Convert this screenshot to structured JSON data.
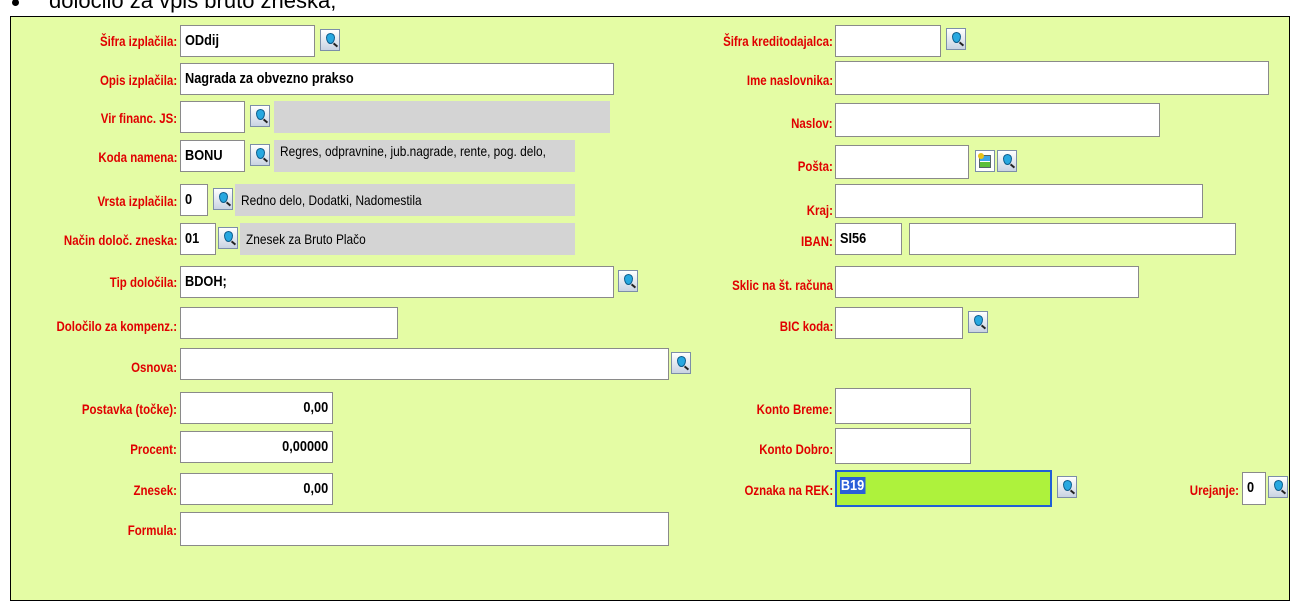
{
  "caption": "določilo za vpis bruto zneska;",
  "left": {
    "sifra_izplacila": {
      "label": "Šifra izplačila:",
      "value": "ODdij"
    },
    "opis_izplacila": {
      "label": "Opis izplačila:",
      "value": "Nagrada za obvezno prakso"
    },
    "vir_financ": {
      "label": "Vir financ. JS:",
      "value": "",
      "desc": ""
    },
    "koda_namena": {
      "label": "Koda namena:",
      "value": "BONU",
      "desc": "Regres, odpravnine, jub.nagrade, rente, pog. delo,"
    },
    "vrsta_izplacila": {
      "label": "Vrsta izplačila:",
      "value": "0",
      "desc": "Redno delo, Dodatki, Nadomestila"
    },
    "nacin_doloc": {
      "label": "Način določ. zneska:",
      "value": "01",
      "desc": "Znesek za Bruto Plačo"
    },
    "tip_dolocila": {
      "label": "Tip določila:",
      "value": "BDOH;"
    },
    "dolocilo_kompenz": {
      "label": "Določilo za kompenz.:",
      "value": ""
    },
    "osnova": {
      "label": "Osnova:",
      "value": ""
    },
    "postavka": {
      "label": "Postavka (točke):",
      "value": "0,00"
    },
    "procent": {
      "label": "Procent:",
      "value": "0,00000"
    },
    "znesek": {
      "label": "Znesek:",
      "value": "0,00"
    },
    "formula": {
      "label": "Formula:",
      "value": ""
    }
  },
  "right": {
    "sifra_kreditodajalca": {
      "label": "Šifra kreditodajalca:",
      "value": ""
    },
    "ime_naslovnika": {
      "label": "Ime naslovnika:",
      "value": ""
    },
    "naslov": {
      "label": "Naslov:",
      "value": ""
    },
    "posta": {
      "label": "Pošta:",
      "value": ""
    },
    "kraj": {
      "label": "Kraj:",
      "value": ""
    },
    "iban": {
      "label": "IBAN:",
      "prefix": "SI56",
      "value": ""
    },
    "sklic": {
      "label": "Sklic na št. računa",
      "value": ""
    },
    "bic": {
      "label": "BIC koda:",
      "value": ""
    },
    "konto_breme": {
      "label": "Konto Breme:",
      "value": ""
    },
    "konto_dobro": {
      "label": "Konto Dobro:",
      "value": ""
    },
    "oznaka_rek": {
      "label": "Oznaka na REK:",
      "value": "B19"
    },
    "urejanje": {
      "label": "Urejanje:",
      "value": "0"
    }
  },
  "icons": {
    "lookup": "lookup-icon",
    "form": "form-icon"
  },
  "colors": {
    "panel_bg": "#e4fca4",
    "label": "#e00000",
    "desc_bg": "#d4d4d4",
    "active_field": "#aef23c"
  }
}
